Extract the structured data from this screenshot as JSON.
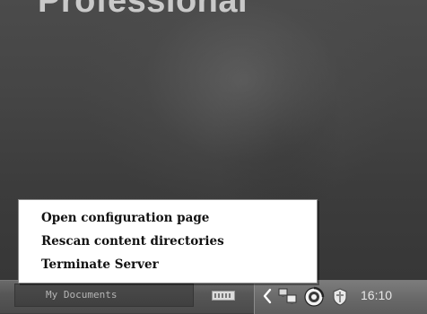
{
  "desktop": {
    "brand_text": "Professional"
  },
  "context_menu": {
    "items": [
      {
        "label": "Open configuration page"
      },
      {
        "label": "Rescan content directories"
      },
      {
        "label": "Terminate Server"
      }
    ]
  },
  "taskbar": {
    "task_button_label": "My Documents",
    "tray": {
      "icons": [
        "chevron-left-icon",
        "network-icon",
        "media-server-icon",
        "shield-icon"
      ],
      "clock": "16:10"
    }
  }
}
